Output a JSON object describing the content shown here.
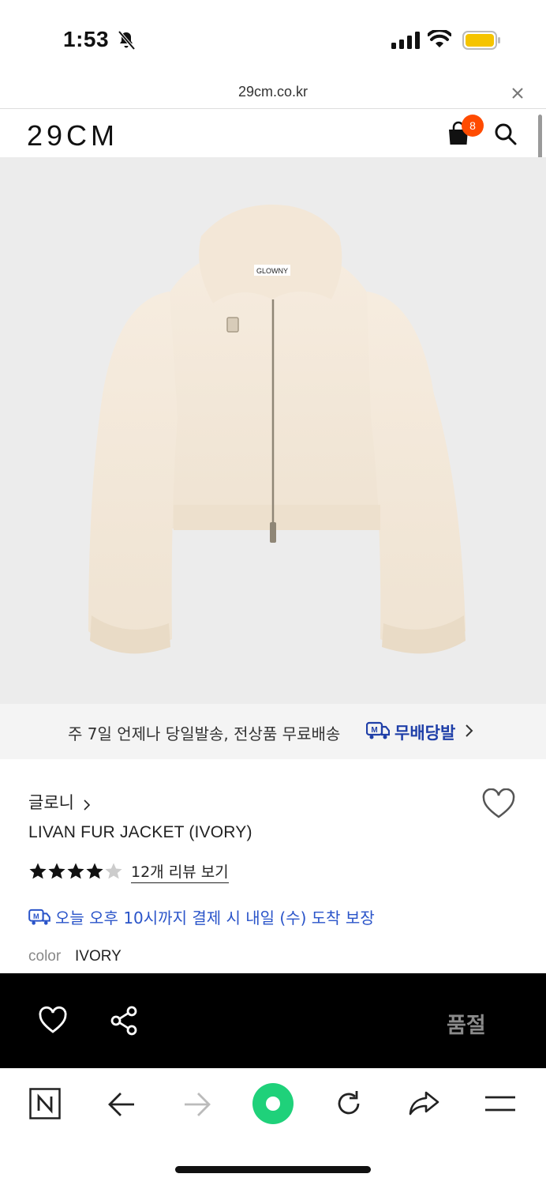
{
  "status_bar": {
    "time": "1:53",
    "icons": [
      "bell-slash-icon",
      "cellular-signal-icon",
      "wifi-icon",
      "battery-icon"
    ],
    "battery_color": "#f5c400"
  },
  "url_bar": {
    "url": "29cm.co.kr",
    "close_icon": "close-icon"
  },
  "header": {
    "logo": "29CM",
    "cart_count": "8",
    "badge_color": "#ff4b00",
    "icons": [
      "shopping-bag-icon",
      "search-icon"
    ]
  },
  "product_image": {
    "image_label": "GLOWNY"
  },
  "shipping_banner": {
    "text": "주 7일 언제나 당일발송, 전상품 무료배송",
    "badge_label": "무배당발",
    "badge_color": "#1f3fa8"
  },
  "product": {
    "brand": "글로니",
    "name": "LIVAN FUR JACKET (IVORY)",
    "rating": 4.5,
    "review_link": "12개 리뷰 보기",
    "delivery_text": "오늘 오후 10시까지 결제 시 내일 (수) 도착 보장",
    "delivery_color": "#2a54c9",
    "color_label": "color",
    "color_value": "IVORY"
  },
  "action_bar": {
    "status": "품절",
    "icons": [
      "heart-icon",
      "share-icon"
    ]
  },
  "browser_toolbar": {
    "icons": [
      "naver-n-icon",
      "back-arrow-icon",
      "forward-arrow-icon",
      "green-circle-icon",
      "reload-icon",
      "share-arrow-icon",
      "menu-icon"
    ]
  }
}
